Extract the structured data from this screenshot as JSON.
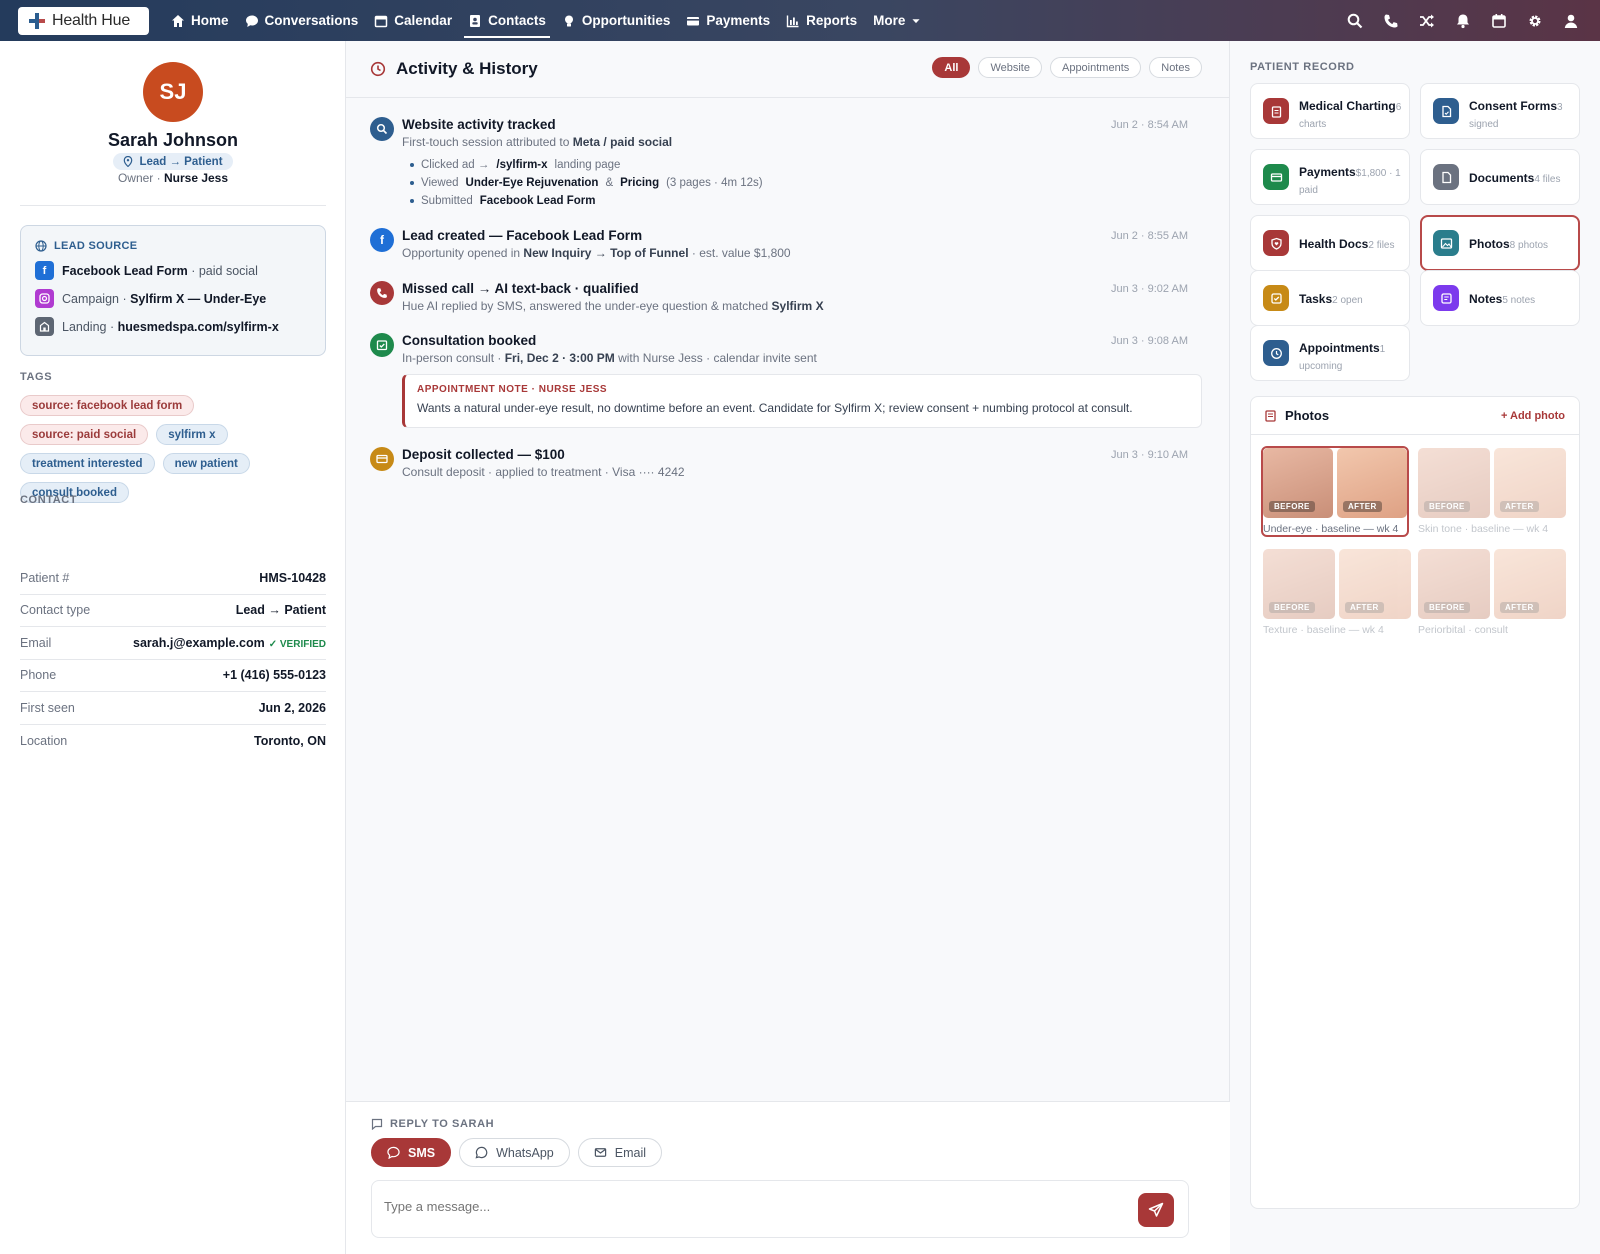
{
  "app": {
    "name": "Health Hue"
  },
  "nav": {
    "items": [
      {
        "label": "Home",
        "icon": "home-icon"
      },
      {
        "label": "Conversations",
        "icon": "chat-icon"
      },
      {
        "label": "Calendar",
        "icon": "calendar-icon"
      },
      {
        "label": "Contacts",
        "icon": "contacts-icon",
        "active": true
      },
      {
        "label": "Opportunities",
        "icon": "lightbulb-icon"
      },
      {
        "label": "Payments",
        "icon": "card-icon"
      },
      {
        "label": "Reports",
        "icon": "bar-chart-icon"
      },
      {
        "label": "More",
        "icon": "caret-down-icon"
      }
    ],
    "right_icons": [
      "search-icon",
      "phone-icon",
      "shuffle-icon",
      "bell-icon",
      "calendar-icon",
      "gear-icon",
      "user-icon"
    ]
  },
  "patient": {
    "initials": "SJ",
    "name": "Sarah Johnson",
    "status": "Lead → Patient",
    "owner_label": "Owner ·",
    "owner": "Nurse Jess"
  },
  "lead_source": {
    "title": "LEAD SOURCE",
    "rows": [
      {
        "strong": "Facebook Lead Form",
        "rest": " · paid social"
      },
      {
        "pre": "Campaign · ",
        "strong": "Sylfirm X — Under-Eye"
      },
      {
        "pre": "Landing · ",
        "strong": "huesmedspa.com/sylfirm-x"
      }
    ]
  },
  "tags": {
    "title": "TAGS",
    "items": [
      "source: facebook lead form",
      "source: paid social",
      "sylfirm x",
      "treatment interested",
      "new patient",
      "consult booked"
    ]
  },
  "contact": {
    "title": "CONTACT",
    "rows": [
      {
        "label": "Patient #",
        "value": "HMS-10428"
      },
      {
        "label": "Contact type",
        "value": "Lead → Patient"
      },
      {
        "label": "Email",
        "value": "sarah.j@example.com",
        "badge": "✓ VERIFIED"
      },
      {
        "label": "Phone",
        "value": "+1 (416) 555-0123"
      },
      {
        "label": "First seen",
        "value": "Jun 2, 2026"
      },
      {
        "label": "Location",
        "value": "Toronto, ON"
      }
    ]
  },
  "activity": {
    "title": "Activity & History",
    "filters": [
      "All",
      "Website",
      "Appointments",
      "Notes"
    ],
    "events": [
      {
        "title": "Website activity tracked",
        "sub_pre": "First-touch session attributed to ",
        "sub_bold": "Meta / paid social",
        "time": "Jun 2 · 8:54 AM",
        "bullets": [
          {
            "a": "Clicked ad →",
            "b": "/sylfirm-x",
            "c": "landing page"
          },
          {
            "a": "Viewed",
            "b": "Under-Eye Rejuvenation",
            "c": "&",
            "d": "Pricing",
            "e": "(3 pages · 4m 12s)"
          },
          {
            "a": "Submitted",
            "b": "Facebook Lead Form"
          }
        ]
      },
      {
        "title": "Lead created — Facebook Lead Form",
        "sub_pre": "Opportunity opened in ",
        "sub_bold": "New Inquiry → Top of Funnel",
        "sub_post": " · est. value $1,800",
        "time": "Jun 2 · 8:55 AM"
      },
      {
        "title": "Missed call → AI text-back · qualified",
        "sub_pre": "Hue AI replied by SMS, answered the under-eye question & matched ",
        "sub_bold": "Sylfirm X",
        "time": "Jun 3 · 9:02 AM"
      },
      {
        "title": "Consultation booked",
        "sub_pre": "In-person consult · ",
        "sub_bold": "Fri, Dec 2 · 3:00 PM",
        "sub_post": " with Nurse Jess · calendar invite sent",
        "time": "Jun 3 · 9:08 AM",
        "note_title": "APPOINTMENT NOTE · NURSE JESS",
        "note_text": "Wants a natural under-eye result, no downtime before an event. Candidate for Sylfirm X; review consent + numbing protocol at consult."
      },
      {
        "title": "Deposit collected — $100",
        "sub_pre": "Consult deposit · applied to treatment · Visa ···· 4242",
        "time": "Jun 3 · 9:10 AM"
      }
    ]
  },
  "reply": {
    "title": "REPLY TO SARAH",
    "channels": [
      "SMS",
      "WhatsApp",
      "Email"
    ],
    "placeholder": "Type a message..."
  },
  "patient_record": {
    "title": "PATIENT RECORD",
    "cards": [
      {
        "title": "Medical Charting",
        "count": "6",
        "sub": "charts",
        "color": "#a83838"
      },
      {
        "title": "Consent Forms",
        "count": "3",
        "sub": "signed",
        "color": "#2e5e8f"
      },
      {
        "title": "Payments",
        "count": "$1,800 · 1",
        "sub": "paid",
        "color": "#1e8a4c"
      },
      {
        "title": "Documents",
        "count": "4 files",
        "sub": "",
        "color": "#6b7280"
      },
      {
        "title": "Health Docs",
        "count": "2 files",
        "sub": "",
        "color": "#a83838"
      },
      {
        "title": "Photos",
        "count": "8 photos",
        "sub": "",
        "color": "#2a7d8c"
      },
      {
        "title": "Tasks",
        "count": "2 open",
        "sub": "",
        "color": "#c78a16"
      },
      {
        "title": "Notes",
        "count": "5 notes",
        "sub": "",
        "color": "#7c3aed"
      },
      {
        "title": "Appointments",
        "count": "1",
        "sub": "upcoming",
        "color": "#2e5e8f"
      }
    ]
  },
  "photos": {
    "title": "Photos",
    "add": "+ Add photo",
    "before": "BEFORE",
    "after": "AFTER",
    "sets": [
      {
        "caption": "Under-eye · baseline — wk 4"
      },
      {
        "caption": "Skin tone · baseline — wk 4"
      },
      {
        "caption": "Texture · baseline — wk 4"
      },
      {
        "caption": "Periorbital · consult"
      }
    ]
  }
}
